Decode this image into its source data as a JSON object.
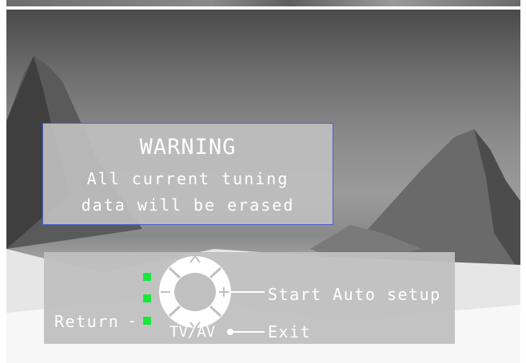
{
  "warning": {
    "title": "WARNING",
    "line1": "All current tuning",
    "line2": "data will be erased"
  },
  "controls": {
    "return_label": "Return",
    "return_dash": "-",
    "start_label": "Start Auto setup",
    "tvav_label": "TV/AV",
    "exit_label": "Exit",
    "up_arrow": "^",
    "down_arrow": "v",
    "minus_symbol": "−",
    "plus_symbol": "+"
  },
  "colors": {
    "indicator": "#18e83a",
    "warning_border": "#4a5fd0",
    "text": "#ffffff"
  }
}
